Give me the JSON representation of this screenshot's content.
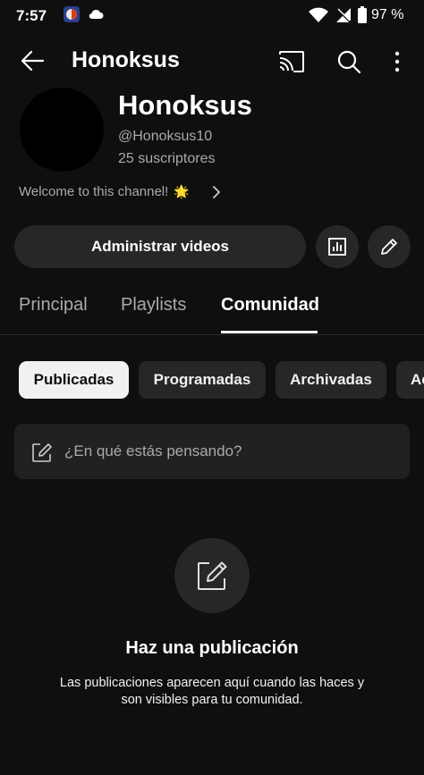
{
  "status_bar": {
    "time": "7:57",
    "battery": "97 %",
    "icons": [
      "app-notification-icon",
      "cloud-icon",
      "wifi-icon",
      "no-sim-icon",
      "battery-icon"
    ]
  },
  "app_bar": {
    "title": "Honoksus",
    "icons": [
      "back-arrow-icon",
      "cast-icon",
      "search-icon",
      "more-vert-icon"
    ]
  },
  "channel": {
    "name": "Honoksus",
    "handle": "@Honoksus10",
    "subscribers": "25 suscriptores",
    "description": "Welcome to this channel!",
    "description_emoji": "🌟"
  },
  "actions": {
    "manage_label": "Administrar videos",
    "icons": [
      "analytics-icon",
      "edit-pencil-icon"
    ]
  },
  "tabs": [
    {
      "label": "Principal",
      "active": false
    },
    {
      "label": "Playlists",
      "active": false
    },
    {
      "label": "Comunidad",
      "active": true
    }
  ],
  "chips": [
    {
      "label": "Publicadas",
      "selected": true
    },
    {
      "label": "Programadas",
      "selected": false
    },
    {
      "label": "Archivadas",
      "selected": false
    },
    {
      "label": "Ac",
      "selected": false
    }
  ],
  "composer": {
    "placeholder": "¿En qué estás pensando?"
  },
  "empty_state": {
    "title": "Haz una publicación",
    "body": "Las publicaciones aparecen aquí cuando las haces y son visibles para tu comunidad."
  },
  "colors": {
    "background": "#0f0f0f",
    "surface": "#272727",
    "text_primary": "#ffffff",
    "text_secondary": "#aaaaaa"
  }
}
